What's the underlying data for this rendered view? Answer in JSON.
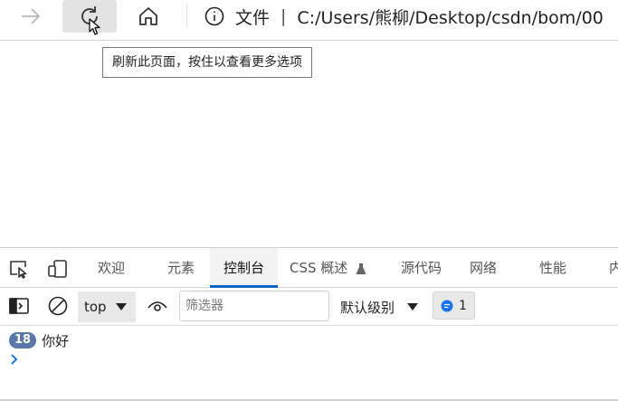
{
  "toolbar": {
    "forward_icon": "arrow-right-icon",
    "refresh_icon": "refresh-icon",
    "home_icon": "home-icon"
  },
  "address": {
    "info_icon": "info-icon",
    "scheme_label": "文件",
    "separator": "|",
    "url": "C:/Users/熊柳/Desktop/csdn/bom/00"
  },
  "tooltip": {
    "text": "刷新此页面，按住以查看更多选项"
  },
  "devtools": {
    "tabs": [
      {
        "label": "欢迎"
      },
      {
        "label": "元素"
      },
      {
        "label": "控制台"
      },
      {
        "label": "CSS 概述"
      },
      {
        "label": "源代码"
      },
      {
        "label": "网络"
      },
      {
        "label": "性能"
      },
      {
        "label": "内"
      }
    ],
    "active_tab": "控制台",
    "accent_color": "#0a66c2"
  },
  "console_toolbar": {
    "context": "top",
    "filter_placeholder": "筛选器",
    "filter_value": "",
    "level": "默认级别",
    "issues_count": "1"
  },
  "console": {
    "messages": [
      {
        "count": "18",
        "text": "你好"
      }
    ],
    "prompt_symbol": "›"
  }
}
